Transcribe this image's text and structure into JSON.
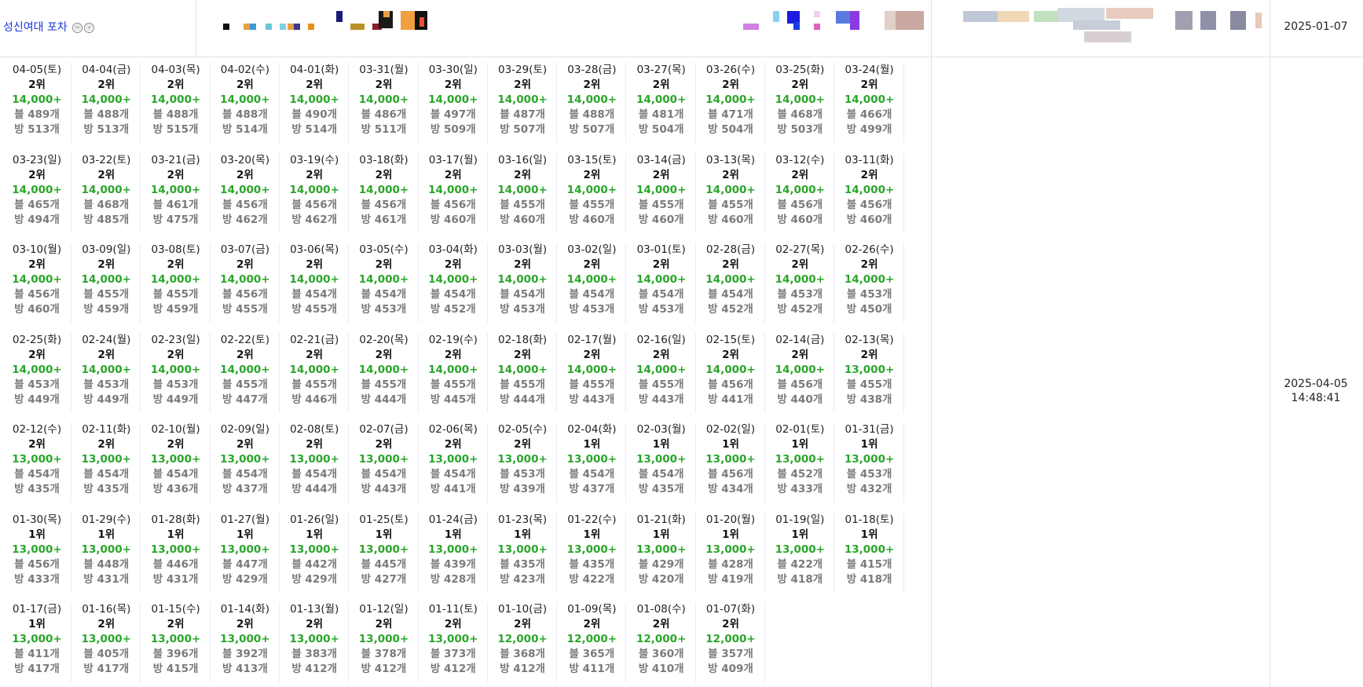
{
  "header": {
    "title": "성신여대 포차",
    "icon_m": "ⓜ",
    "icon_p": "ⓟ",
    "start_date": "2025-01-07",
    "updated_date": "2025-04-05",
    "updated_time": "14:48:41"
  },
  "colors": {
    "link": "#1a35d9",
    "views": "#2aa52a",
    "muted": "#7a7a7a"
  },
  "days": [
    {
      "date": "04-05(토)",
      "rank": "2위",
      "views": "14,000+",
      "blog": "블 489개",
      "room": "방 513개"
    },
    {
      "date": "04-04(금)",
      "rank": "2위",
      "views": "14,000+",
      "blog": "블 488개",
      "room": "방 513개"
    },
    {
      "date": "04-03(목)",
      "rank": "2위",
      "views": "14,000+",
      "blog": "블 488개",
      "room": "방 515개"
    },
    {
      "date": "04-02(수)",
      "rank": "2위",
      "views": "14,000+",
      "blog": "블 488개",
      "room": "방 514개"
    },
    {
      "date": "04-01(화)",
      "rank": "2위",
      "views": "14,000+",
      "blog": "블 490개",
      "room": "방 514개"
    },
    {
      "date": "03-31(월)",
      "rank": "2위",
      "views": "14,000+",
      "blog": "블 486개",
      "room": "방 511개"
    },
    {
      "date": "03-30(일)",
      "rank": "2위",
      "views": "14,000+",
      "blog": "블 497개",
      "room": "방 509개"
    },
    {
      "date": "03-29(토)",
      "rank": "2위",
      "views": "14,000+",
      "blog": "블 487개",
      "room": "방 507개"
    },
    {
      "date": "03-28(금)",
      "rank": "2위",
      "views": "14,000+",
      "blog": "블 488개",
      "room": "방 507개"
    },
    {
      "date": "03-27(목)",
      "rank": "2위",
      "views": "14,000+",
      "blog": "블 481개",
      "room": "방 504개"
    },
    {
      "date": "03-26(수)",
      "rank": "2위",
      "views": "14,000+",
      "blog": "블 471개",
      "room": "방 504개"
    },
    {
      "date": "03-25(화)",
      "rank": "2위",
      "views": "14,000+",
      "blog": "블 468개",
      "room": "방 503개"
    },
    {
      "date": "03-24(월)",
      "rank": "2위",
      "views": "14,000+",
      "blog": "블 466개",
      "room": "방 499개"
    },
    {
      "date": "03-23(일)",
      "rank": "2위",
      "views": "14,000+",
      "blog": "블 465개",
      "room": "방 494개"
    },
    {
      "date": "03-22(토)",
      "rank": "2위",
      "views": "14,000+",
      "blog": "블 468개",
      "room": "방 485개"
    },
    {
      "date": "03-21(금)",
      "rank": "2위",
      "views": "14,000+",
      "blog": "블 461개",
      "room": "방 475개"
    },
    {
      "date": "03-20(목)",
      "rank": "2위",
      "views": "14,000+",
      "blog": "블 456개",
      "room": "방 462개"
    },
    {
      "date": "03-19(수)",
      "rank": "2위",
      "views": "14,000+",
      "blog": "블 456개",
      "room": "방 462개"
    },
    {
      "date": "03-18(화)",
      "rank": "2위",
      "views": "14,000+",
      "blog": "블 456개",
      "room": "방 461개"
    },
    {
      "date": "03-17(월)",
      "rank": "2위",
      "views": "14,000+",
      "blog": "블 456개",
      "room": "방 460개"
    },
    {
      "date": "03-16(일)",
      "rank": "2위",
      "views": "14,000+",
      "blog": "블 455개",
      "room": "방 460개"
    },
    {
      "date": "03-15(토)",
      "rank": "2위",
      "views": "14,000+",
      "blog": "블 455개",
      "room": "방 460개"
    },
    {
      "date": "03-14(금)",
      "rank": "2위",
      "views": "14,000+",
      "blog": "블 455개",
      "room": "방 460개"
    },
    {
      "date": "03-13(목)",
      "rank": "2위",
      "views": "14,000+",
      "blog": "블 455개",
      "room": "방 460개"
    },
    {
      "date": "03-12(수)",
      "rank": "2위",
      "views": "14,000+",
      "blog": "블 456개",
      "room": "방 460개"
    },
    {
      "date": "03-11(화)",
      "rank": "2위",
      "views": "14,000+",
      "blog": "블 456개",
      "room": "방 460개"
    },
    {
      "date": "03-10(월)",
      "rank": "2위",
      "views": "14,000+",
      "blog": "블 456개",
      "room": "방 460개"
    },
    {
      "date": "03-09(일)",
      "rank": "2위",
      "views": "14,000+",
      "blog": "블 455개",
      "room": "방 459개"
    },
    {
      "date": "03-08(토)",
      "rank": "2위",
      "views": "14,000+",
      "blog": "블 455개",
      "room": "방 459개"
    },
    {
      "date": "03-07(금)",
      "rank": "2위",
      "views": "14,000+",
      "blog": "블 456개",
      "room": "방 455개"
    },
    {
      "date": "03-06(목)",
      "rank": "2위",
      "views": "14,000+",
      "blog": "블 454개",
      "room": "방 455개"
    },
    {
      "date": "03-05(수)",
      "rank": "2위",
      "views": "14,000+",
      "blog": "블 454개",
      "room": "방 453개"
    },
    {
      "date": "03-04(화)",
      "rank": "2위",
      "views": "14,000+",
      "blog": "블 454개",
      "room": "방 452개"
    },
    {
      "date": "03-03(월)",
      "rank": "2위",
      "views": "14,000+",
      "blog": "블 454개",
      "room": "방 453개"
    },
    {
      "date": "03-02(일)",
      "rank": "2위",
      "views": "14,000+",
      "blog": "블 454개",
      "room": "방 453개"
    },
    {
      "date": "03-01(토)",
      "rank": "2위",
      "views": "14,000+",
      "blog": "블 454개",
      "room": "방 453개"
    },
    {
      "date": "02-28(금)",
      "rank": "2위",
      "views": "14,000+",
      "blog": "블 454개",
      "room": "방 452개"
    },
    {
      "date": "02-27(목)",
      "rank": "2위",
      "views": "14,000+",
      "blog": "블 453개",
      "room": "방 452개"
    },
    {
      "date": "02-26(수)",
      "rank": "2위",
      "views": "14,000+",
      "blog": "블 453개",
      "room": "방 450개"
    },
    {
      "date": "02-25(화)",
      "rank": "2위",
      "views": "14,000+",
      "blog": "블 453개",
      "room": "방 449개"
    },
    {
      "date": "02-24(월)",
      "rank": "2위",
      "views": "14,000+",
      "blog": "블 453개",
      "room": "방 449개"
    },
    {
      "date": "02-23(일)",
      "rank": "2위",
      "views": "14,000+",
      "blog": "블 453개",
      "room": "방 449개"
    },
    {
      "date": "02-22(토)",
      "rank": "2위",
      "views": "14,000+",
      "blog": "블 455개",
      "room": "방 447개"
    },
    {
      "date": "02-21(금)",
      "rank": "2위",
      "views": "14,000+",
      "blog": "블 455개",
      "room": "방 446개"
    },
    {
      "date": "02-20(목)",
      "rank": "2위",
      "views": "14,000+",
      "blog": "블 455개",
      "room": "방 444개"
    },
    {
      "date": "02-19(수)",
      "rank": "2위",
      "views": "14,000+",
      "blog": "블 455개",
      "room": "방 445개"
    },
    {
      "date": "02-18(화)",
      "rank": "2위",
      "views": "14,000+",
      "blog": "블 455개",
      "room": "방 444개"
    },
    {
      "date": "02-17(월)",
      "rank": "2위",
      "views": "14,000+",
      "blog": "블 455개",
      "room": "방 443개"
    },
    {
      "date": "02-16(일)",
      "rank": "2위",
      "views": "14,000+",
      "blog": "블 455개",
      "room": "방 443개"
    },
    {
      "date": "02-15(토)",
      "rank": "2위",
      "views": "14,000+",
      "blog": "블 456개",
      "room": "방 441개"
    },
    {
      "date": "02-14(금)",
      "rank": "2위",
      "views": "14,000+",
      "blog": "블 456개",
      "room": "방 440개"
    },
    {
      "date": "02-13(목)",
      "rank": "2위",
      "views": "13,000+",
      "blog": "블 455개",
      "room": "방 438개"
    },
    {
      "date": "02-12(수)",
      "rank": "2위",
      "views": "13,000+",
      "blog": "블 454개",
      "room": "방 435개"
    },
    {
      "date": "02-11(화)",
      "rank": "2위",
      "views": "13,000+",
      "blog": "블 454개",
      "room": "방 435개"
    },
    {
      "date": "02-10(월)",
      "rank": "2위",
      "views": "13,000+",
      "blog": "블 454개",
      "room": "방 436개"
    },
    {
      "date": "02-09(일)",
      "rank": "2위",
      "views": "13,000+",
      "blog": "블 454개",
      "room": "방 437개"
    },
    {
      "date": "02-08(토)",
      "rank": "2위",
      "views": "13,000+",
      "blog": "블 454개",
      "room": "방 444개"
    },
    {
      "date": "02-07(금)",
      "rank": "2위",
      "views": "13,000+",
      "blog": "블 454개",
      "room": "방 443개"
    },
    {
      "date": "02-06(목)",
      "rank": "2위",
      "views": "13,000+",
      "blog": "블 454개",
      "room": "방 441개"
    },
    {
      "date": "02-05(수)",
      "rank": "2위",
      "views": "13,000+",
      "blog": "블 453개",
      "room": "방 439개"
    },
    {
      "date": "02-04(화)",
      "rank": "1위",
      "views": "13,000+",
      "blog": "블 454개",
      "room": "방 437개"
    },
    {
      "date": "02-03(월)",
      "rank": "1위",
      "views": "13,000+",
      "blog": "블 454개",
      "room": "방 435개"
    },
    {
      "date": "02-02(일)",
      "rank": "1위",
      "views": "13,000+",
      "blog": "블 456개",
      "room": "방 434개"
    },
    {
      "date": "02-01(토)",
      "rank": "1위",
      "views": "13,000+",
      "blog": "블 452개",
      "room": "방 433개"
    },
    {
      "date": "01-31(금)",
      "rank": "1위",
      "views": "13,000+",
      "blog": "블 453개",
      "room": "방 432개"
    },
    {
      "date": "01-30(목)",
      "rank": "1위",
      "views": "13,000+",
      "blog": "블 456개",
      "room": "방 433개"
    },
    {
      "date": "01-29(수)",
      "rank": "1위",
      "views": "13,000+",
      "blog": "블 448개",
      "room": "방 431개"
    },
    {
      "date": "01-28(화)",
      "rank": "1위",
      "views": "13,000+",
      "blog": "블 446개",
      "room": "방 431개"
    },
    {
      "date": "01-27(월)",
      "rank": "1위",
      "views": "13,000+",
      "blog": "블 447개",
      "room": "방 429개"
    },
    {
      "date": "01-26(일)",
      "rank": "1위",
      "views": "13,000+",
      "blog": "블 442개",
      "room": "방 429개"
    },
    {
      "date": "01-25(토)",
      "rank": "1위",
      "views": "13,000+",
      "blog": "블 445개",
      "room": "방 427개"
    },
    {
      "date": "01-24(금)",
      "rank": "1위",
      "views": "13,000+",
      "blog": "블 439개",
      "room": "방 428개"
    },
    {
      "date": "01-23(목)",
      "rank": "1위",
      "views": "13,000+",
      "blog": "블 435개",
      "room": "방 423개"
    },
    {
      "date": "01-22(수)",
      "rank": "1위",
      "views": "13,000+",
      "blog": "블 435개",
      "room": "방 422개"
    },
    {
      "date": "01-21(화)",
      "rank": "1위",
      "views": "13,000+",
      "blog": "블 429개",
      "room": "방 420개"
    },
    {
      "date": "01-20(월)",
      "rank": "1위",
      "views": "13,000+",
      "blog": "블 428개",
      "room": "방 419개"
    },
    {
      "date": "01-19(일)",
      "rank": "1위",
      "views": "13,000+",
      "blog": "블 422개",
      "room": "방 418개"
    },
    {
      "date": "01-18(토)",
      "rank": "1위",
      "views": "13,000+",
      "blog": "블 415개",
      "room": "방 418개"
    },
    {
      "date": "01-17(금)",
      "rank": "1위",
      "views": "13,000+",
      "blog": "블 411개",
      "room": "방 417개"
    },
    {
      "date": "01-16(목)",
      "rank": "2위",
      "views": "13,000+",
      "blog": "블 405개",
      "room": "방 417개"
    },
    {
      "date": "01-15(수)",
      "rank": "2위",
      "views": "13,000+",
      "blog": "블 396개",
      "room": "방 415개"
    },
    {
      "date": "01-14(화)",
      "rank": "2위",
      "views": "13,000+",
      "blog": "블 392개",
      "room": "방 413개"
    },
    {
      "date": "01-13(월)",
      "rank": "2위",
      "views": "13,000+",
      "blog": "블 383개",
      "room": "방 412개"
    },
    {
      "date": "01-12(일)",
      "rank": "2위",
      "views": "13,000+",
      "blog": "블 378개",
      "room": "방 412개"
    },
    {
      "date": "01-11(토)",
      "rank": "2위",
      "views": "13,000+",
      "blog": "블 373개",
      "room": "방 412개"
    },
    {
      "date": "01-10(금)",
      "rank": "2위",
      "views": "12,000+",
      "blog": "블 368개",
      "room": "방 412개"
    },
    {
      "date": "01-09(목)",
      "rank": "2위",
      "views": "12,000+",
      "blog": "블 365개",
      "room": "방 411개"
    },
    {
      "date": "01-08(수)",
      "rank": "2위",
      "views": "12,000+",
      "blog": "블 360개",
      "room": "방 410개"
    },
    {
      "date": "01-07(화)",
      "rank": "2위",
      "views": "12,000+",
      "blog": "블 357개",
      "room": "방 409개"
    }
  ]
}
